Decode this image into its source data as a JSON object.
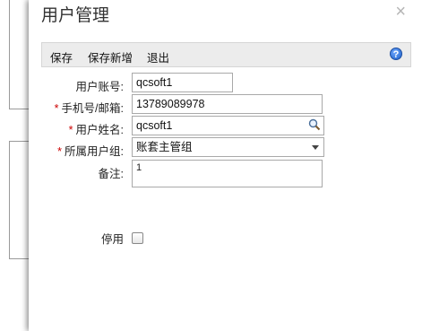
{
  "dialog": {
    "title": "用户管理",
    "close_glyph": "×"
  },
  "toolbar": {
    "save_label": "保存",
    "save_new_label": "保存新增",
    "exit_label": "退出",
    "help_glyph": "?"
  },
  "form": {
    "account": {
      "label": "用户账号:",
      "value": "qcsoft1",
      "required": false
    },
    "phone": {
      "label": "手机号/邮箱:",
      "value": "13789089978",
      "required": true
    },
    "name": {
      "label": "用户姓名:",
      "value": "qcsoft1",
      "required": true
    },
    "group": {
      "label": "所属用户组:",
      "value": "账套主管组",
      "required": true
    },
    "remark": {
      "label": "备注:",
      "value": "1"
    },
    "disabled": {
      "label": "停用",
      "checked": false
    }
  },
  "required_mark": "*"
}
